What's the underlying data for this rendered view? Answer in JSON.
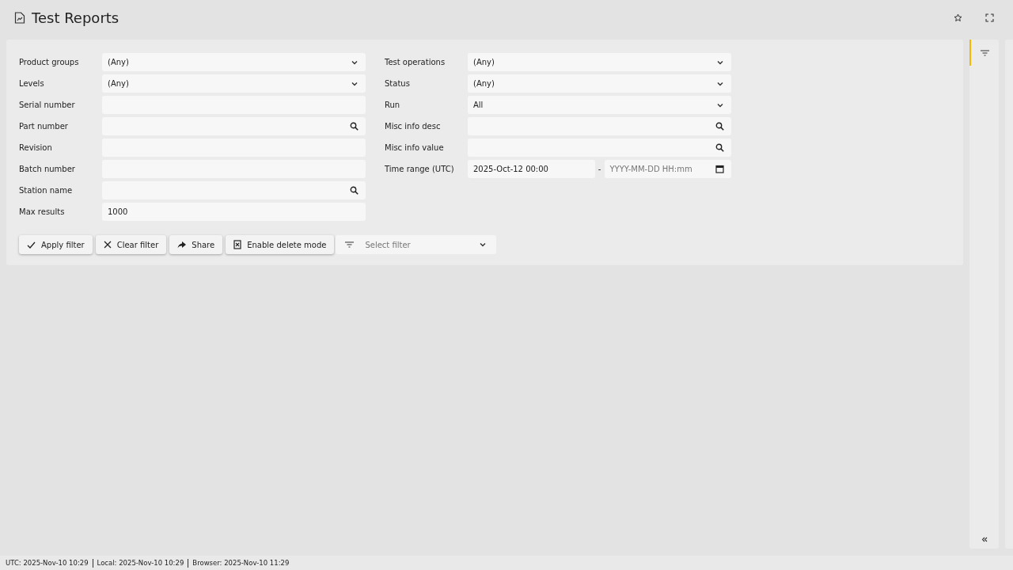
{
  "header": {
    "title": "Test Reports"
  },
  "filters": {
    "left": [
      {
        "label": "Product groups",
        "kind": "select",
        "value": "(Any)"
      },
      {
        "label": "Levels",
        "kind": "select",
        "value": "(Any)"
      },
      {
        "label": "Serial number",
        "kind": "text"
      },
      {
        "label": "Part number",
        "kind": "search"
      },
      {
        "label": "Revision",
        "kind": "text"
      },
      {
        "label": "Batch number",
        "kind": "text"
      },
      {
        "label": "Station name",
        "kind": "search"
      },
      {
        "label": "Max results",
        "kind": "text",
        "value": "1000"
      }
    ],
    "right": [
      {
        "label": "Test operations",
        "kind": "select",
        "value": "(Any)"
      },
      {
        "label": "Status",
        "kind": "select",
        "value": "(Any)"
      },
      {
        "label": "Run",
        "kind": "select",
        "value": "All"
      },
      {
        "label": "Misc info desc",
        "kind": "search"
      },
      {
        "label": "Misc info value",
        "kind": "search"
      },
      {
        "label": "Time range (UTC)",
        "kind": "daterange",
        "value": "2025-Oct-12 00:00",
        "separator": "-",
        "end_placeholder": "YYYY-MM-DD HH:mm"
      }
    ]
  },
  "actions": [
    {
      "label": "Apply filter",
      "kind": "apply"
    },
    {
      "label": "Clear filter",
      "kind": "clear"
    },
    {
      "label": "Share",
      "kind": "share"
    },
    {
      "label": "Enable delete mode",
      "kind": "delete"
    }
  ],
  "saved_filter": {
    "placeholder": "Select filter"
  },
  "side_rail": {
    "tabs": [
      {
        "kind": "filter",
        "selected": true
      }
    ]
  },
  "status_bar": [
    "UTC: 2025-Nov-10 10:29",
    "Local: 2025-Nov-10 10:29",
    "Browser: 2025-Nov-10 11:29"
  ]
}
